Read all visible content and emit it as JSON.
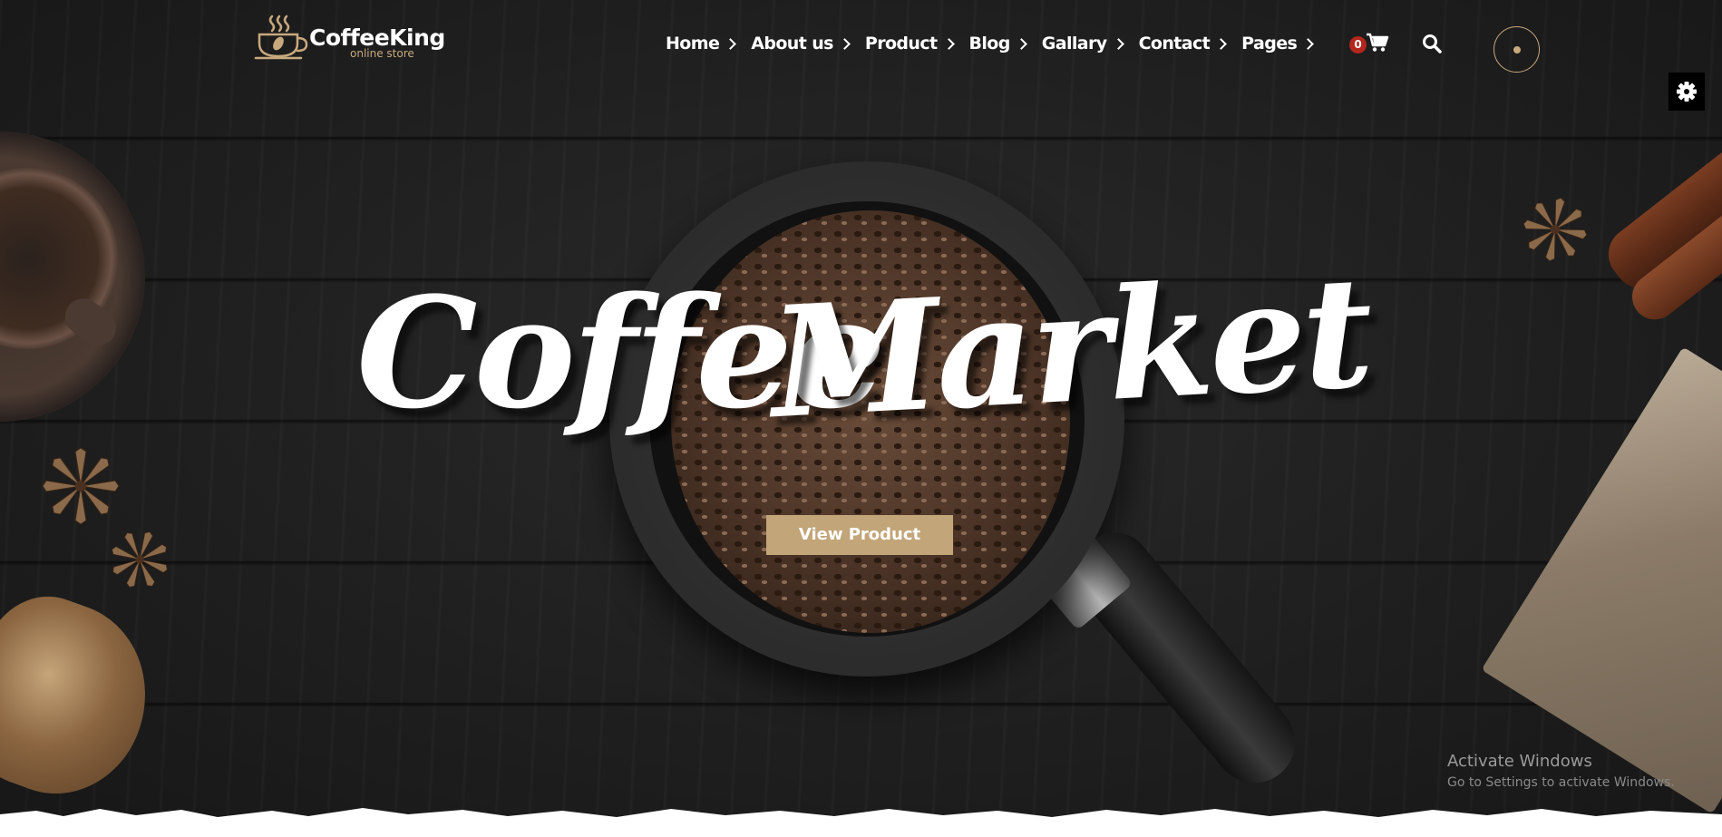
{
  "brand": {
    "name": "CoffeeKing",
    "tagline": "online store",
    "accent_color": "#c8a97e"
  },
  "nav": {
    "items": [
      {
        "label": "Home",
        "has_submenu": true
      },
      {
        "label": "About us",
        "has_submenu": true
      },
      {
        "label": "Product",
        "has_submenu": true
      },
      {
        "label": "Blog",
        "has_submenu": true
      },
      {
        "label": "Gallary",
        "has_submenu": true
      },
      {
        "label": "Contact",
        "has_submenu": true
      },
      {
        "label": "Pages",
        "has_submenu": true
      }
    ],
    "cart_count": "0",
    "cart_icon": "shopping-cart-icon",
    "search_icon": "search-icon"
  },
  "hero": {
    "headline_word1": "Coffee",
    "headline_word2": "Market",
    "cta_label": "View Product",
    "cta_color": "#c2a578",
    "background_color": "#1f1f1f"
  },
  "settings_icon": "gear-icon",
  "os_watermark": {
    "title": "Activate Windows",
    "subtitle": "Go to Settings to activate Windows."
  }
}
